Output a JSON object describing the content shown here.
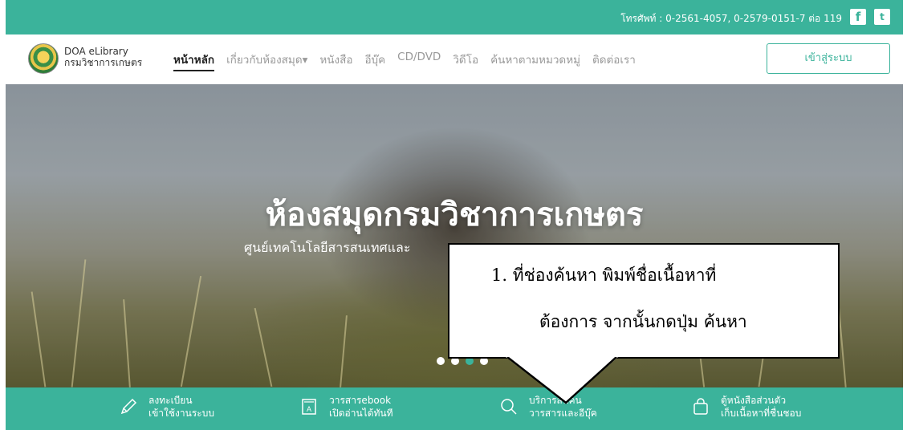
{
  "topbar": {
    "phone": "โทรศัพท์ : 0-2561-4057, 0-2579-0151-7 ต่อ 119",
    "social": [
      "facebook-icon",
      "twitter-icon"
    ]
  },
  "brand": {
    "name_en": "DOA eLibrary",
    "name_th": "กรมวิชาการเกษตร"
  },
  "nav": {
    "items": [
      {
        "label": "หน้าหลัก"
      },
      {
        "label": "เกี่ยวกับห้องสมุด▾"
      },
      {
        "label": "หนังสือ"
      },
      {
        "label": "อีบุ๊ค"
      },
      {
        "label": "CD/DVD"
      },
      {
        "label": "วิดีโอ"
      },
      {
        "label": "ค้นหาตามหมวดหมู่"
      },
      {
        "label": "ติดต่อเรา"
      }
    ],
    "login": "เข้าสู่ระบบ"
  },
  "hero": {
    "title": "ห้องสมุดกรมวิชาการเกษตร",
    "subtitle": "ศูนย์เทคโนโลยีสารสนเทศและ"
  },
  "callout": {
    "line1": "1.   ที่ช่องค้นหา     พิมพ์ชื่อเนื้อหาที่",
    "line2": "ต้องการ จากนั้นกดปุ่ม ค้นหา"
  },
  "features": [
    {
      "line1": "ลงทะเบียน",
      "line2": "เข้าใช้งานระบบ",
      "icon": "pencil-icon"
    },
    {
      "line1": "วารสารebook",
      "line2": "เปิดอ่านได้ทันที",
      "icon": "book-icon"
    },
    {
      "line1": "บริการสืบค้น",
      "line2": "วารสารและอีบุ๊ค",
      "icon": "search-icon"
    },
    {
      "line1": "ตู้หนังสือส่วนตัว",
      "line2": "เก็บเนื้อหาที่ชื่นชอบ",
      "icon": "bag-icon"
    }
  ],
  "colors": {
    "accent": "#3bb39b"
  }
}
